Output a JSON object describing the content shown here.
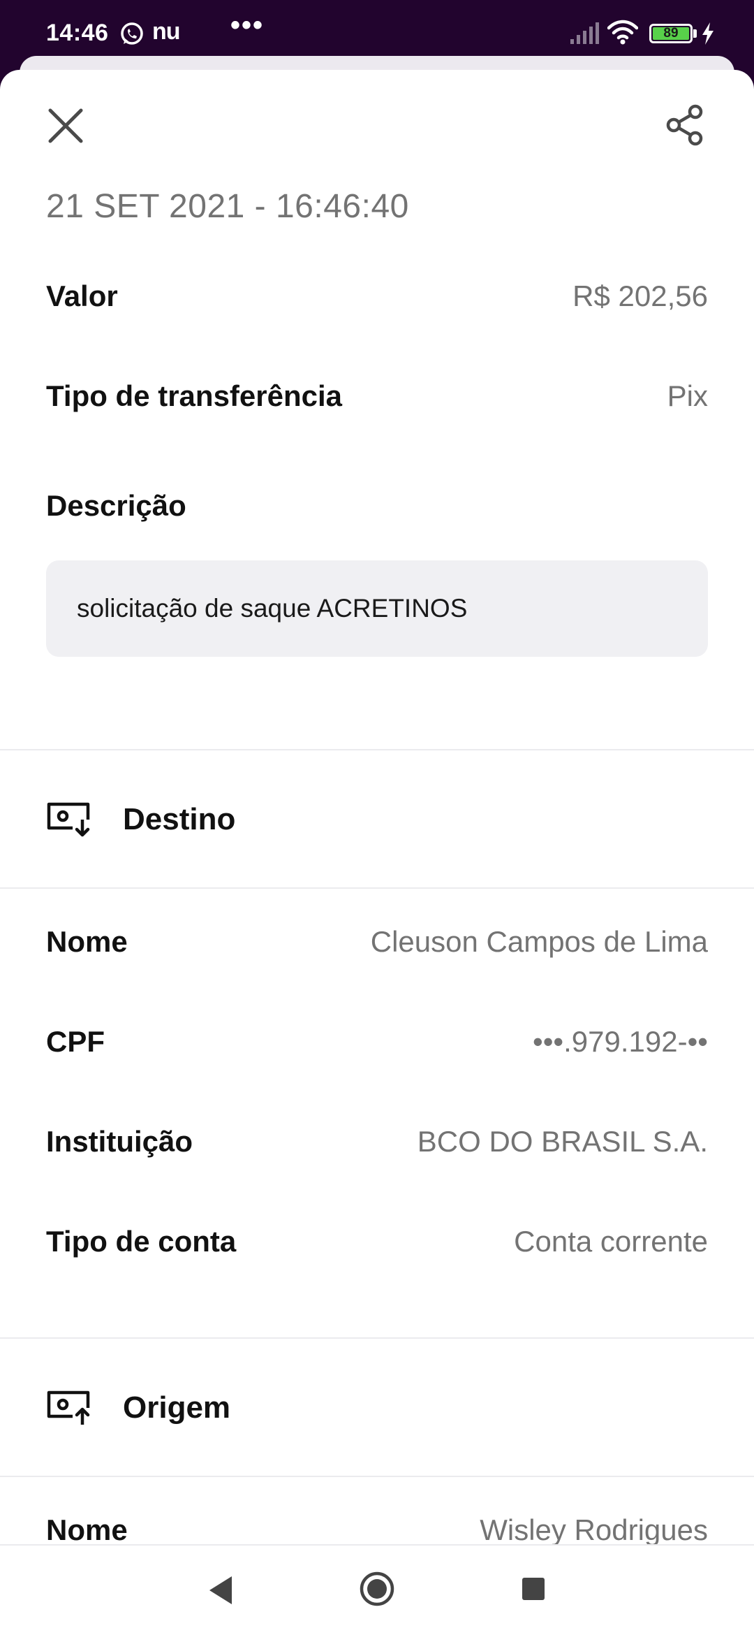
{
  "status_bar": {
    "time": "14:46",
    "app_label": "nu",
    "more": "•••",
    "battery": "89"
  },
  "header": {
    "datetime": "21 SET 2021 - 16:46:40"
  },
  "transfer": {
    "value_label": "Valor",
    "value": "R$ 202,56",
    "type_label": "Tipo de transferência",
    "type": "Pix",
    "description_label": "Descrição",
    "description": "solicitação de saque ACRETINOS"
  },
  "destination": {
    "title": "Destino",
    "name_label": "Nome",
    "name": "Cleuson Campos de Lima",
    "cpf_label": "CPF",
    "cpf": "•••.979.192-••",
    "institution_label": "Instituição",
    "institution": "BCO DO BRASIL S.A.",
    "account_type_label": "Tipo de conta",
    "account_type": "Conta corrente"
  },
  "origin": {
    "title": "Origem",
    "name_label": "Nome",
    "name": "Wisley Rodrigues"
  }
}
